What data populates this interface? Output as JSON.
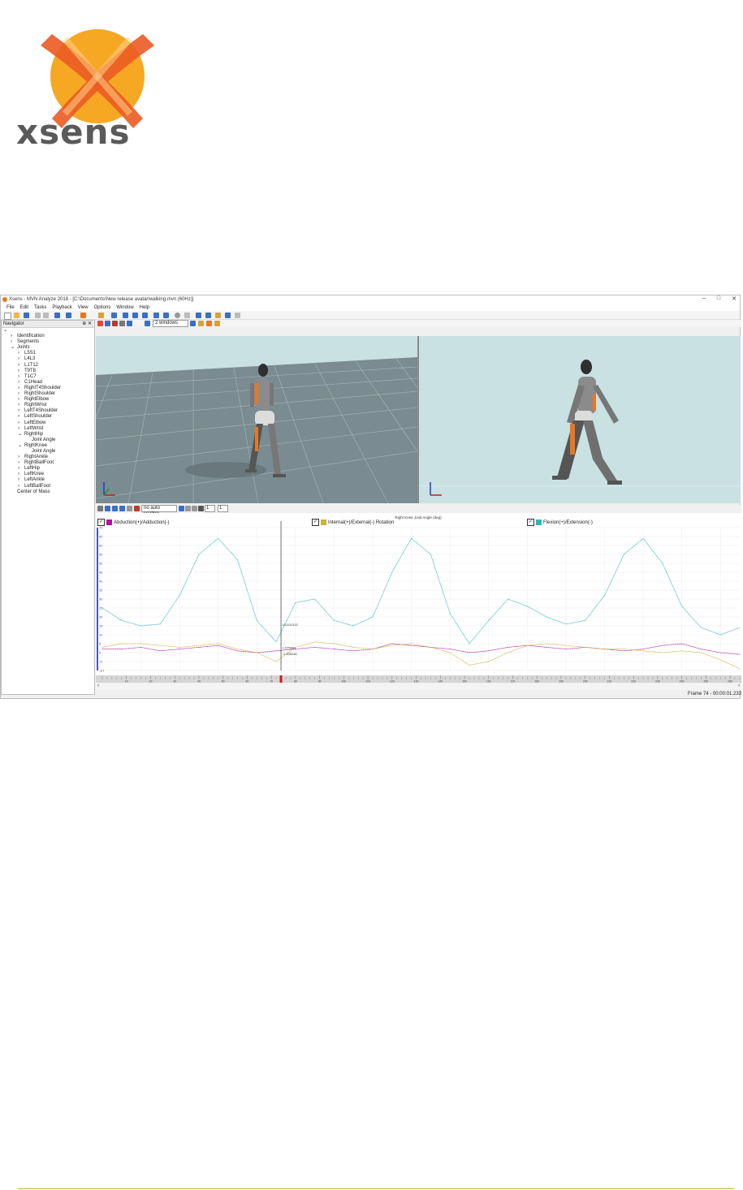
{
  "brand": {
    "name": "xsens"
  },
  "window": {
    "title": "Xsens - MVN Analyze 2018 - [C:\\Documents\\New release avatar\\walking.mvn (60Hz)]",
    "minimize": "–",
    "maximize": "□",
    "close": "✕"
  },
  "menu": [
    "File",
    "Edit",
    "Tasks",
    "Playback",
    "View",
    "Options",
    "Window",
    "Help"
  ],
  "navigator": {
    "title": "Navigator",
    "items": [
      {
        "label": "",
        "indent": 0,
        "expander": "open"
      },
      {
        "label": "Identification",
        "indent": 1,
        "expander": "closed"
      },
      {
        "label": "Segments",
        "indent": 1,
        "expander": "closed"
      },
      {
        "label": "Joints",
        "indent": 1,
        "expander": "open"
      },
      {
        "label": "L5S1",
        "indent": 2,
        "expander": "closed"
      },
      {
        "label": "L4L3",
        "indent": 2,
        "expander": "closed"
      },
      {
        "label": "L1T12",
        "indent": 2,
        "expander": "closed"
      },
      {
        "label": "T9T8",
        "indent": 2,
        "expander": "closed"
      },
      {
        "label": "T1C7",
        "indent": 2,
        "expander": "closed"
      },
      {
        "label": "C1Head",
        "indent": 2,
        "expander": "closed"
      },
      {
        "label": "RightT4Shoulder",
        "indent": 2,
        "expander": "closed"
      },
      {
        "label": "RightShoulder",
        "indent": 2,
        "expander": "closed"
      },
      {
        "label": "RightElbow",
        "indent": 2,
        "expander": "closed"
      },
      {
        "label": "RightWrist",
        "indent": 2,
        "expander": "closed"
      },
      {
        "label": "LeftT4Shoulder",
        "indent": 2,
        "expander": "closed"
      },
      {
        "label": "LeftShoulder",
        "indent": 2,
        "expander": "closed"
      },
      {
        "label": "LeftElbow",
        "indent": 2,
        "expander": "closed"
      },
      {
        "label": "LeftWrist",
        "indent": 2,
        "expander": "closed"
      },
      {
        "label": "RightHip",
        "indent": 2,
        "expander": "open"
      },
      {
        "label": "Joint Angle",
        "indent": 3,
        "expander": "none"
      },
      {
        "label": "RightKnee",
        "indent": 2,
        "expander": "open"
      },
      {
        "label": "Joint Angle",
        "indent": 3,
        "expander": "none"
      },
      {
        "label": "RightAnkle",
        "indent": 2,
        "expander": "closed"
      },
      {
        "label": "RightBallFoot",
        "indent": 2,
        "expander": "closed"
      },
      {
        "label": "LeftHip",
        "indent": 2,
        "expander": "closed"
      },
      {
        "label": "LeftKnee",
        "indent": 2,
        "expander": "closed"
      },
      {
        "label": "LeftAnkle",
        "indent": 2,
        "expander": "closed"
      },
      {
        "label": "LeftBallFoot",
        "indent": 2,
        "expander": "closed"
      },
      {
        "label": "Center of Mass",
        "indent": 1,
        "expander": "none"
      }
    ]
  },
  "view_toolbar": {
    "layout_select": "2 windows"
  },
  "graph_toolbar": {
    "scaling_select": "no auto scaling",
    "rows": "1",
    "cols": "1"
  },
  "colors": {
    "abduction": "#b0149e",
    "rotation": "#c7b43a",
    "flexion": "#2bb7b5",
    "floor": "#7a8c91",
    "sky": "#c9e1e3",
    "accent": "#e87722"
  },
  "chart_data": {
    "type": "line",
    "title": "Right Knee Joint Angle (deg)",
    "x": [
      0,
      8,
      16,
      24,
      32,
      40,
      48,
      56,
      64,
      72,
      80,
      88,
      96,
      104,
      112,
      120,
      128,
      136,
      144,
      152,
      160,
      168,
      176,
      184,
      192,
      200,
      208,
      216,
      224,
      232,
      240,
      248,
      256,
      264
    ],
    "xlim": [
      0,
      264
    ],
    "ylim": [
      -10,
      70
    ],
    "yticks": [
      70,
      65,
      60,
      55,
      50,
      45,
      40,
      35,
      30,
      25,
      20,
      15,
      10,
      5,
      0,
      -5,
      -10
    ],
    "xticks": [
      10,
      20,
      30,
      40,
      50,
      60,
      70,
      80,
      90,
      100,
      110,
      120,
      130,
      140,
      150,
      160,
      170,
      180,
      190,
      200,
      210,
      220,
      230,
      240,
      250,
      260
    ],
    "cursor_x": 74,
    "cursor_labels": [
      "15.021313",
      "1.075881",
      "-1.398146"
    ],
    "series": [
      {
        "name": "Abduction(+)/Adduction(-)",
        "color": "#b0149e",
        "values": [
          2,
          2,
          3,
          1,
          2,
          3,
          4,
          1,
          0,
          1,
          2,
          3,
          2,
          1,
          2,
          5,
          4,
          3,
          2,
          0,
          1,
          3,
          4,
          3,
          2,
          3,
          2,
          1,
          2,
          4,
          5,
          2,
          0,
          -1
        ]
      },
      {
        "name": "Internal(+)/External(-) Rotation",
        "color": "#c7b43a",
        "values": [
          3,
          5,
          5,
          4,
          3,
          4,
          5,
          2,
          0,
          -5,
          3,
          6,
          5,
          3,
          2,
          4,
          5,
          3,
          0,
          -7,
          -5,
          0,
          4,
          5,
          4,
          3,
          2,
          2,
          1,
          0,
          1,
          0,
          -4,
          -9
        ]
      },
      {
        "name": "Flexion(+)/Extension(-)",
        "color": "#2bb7b5",
        "values": [
          25,
          18,
          15,
          16,
          32,
          55,
          64,
          52,
          18,
          6,
          28,
          30,
          18,
          15,
          20,
          45,
          64,
          55,
          22,
          5,
          18,
          30,
          26,
          20,
          16,
          18,
          32,
          55,
          64,
          50,
          26,
          14,
          10,
          14
        ]
      }
    ]
  },
  "status": {
    "frame": "Frame 74 - 00:00:01.233"
  }
}
